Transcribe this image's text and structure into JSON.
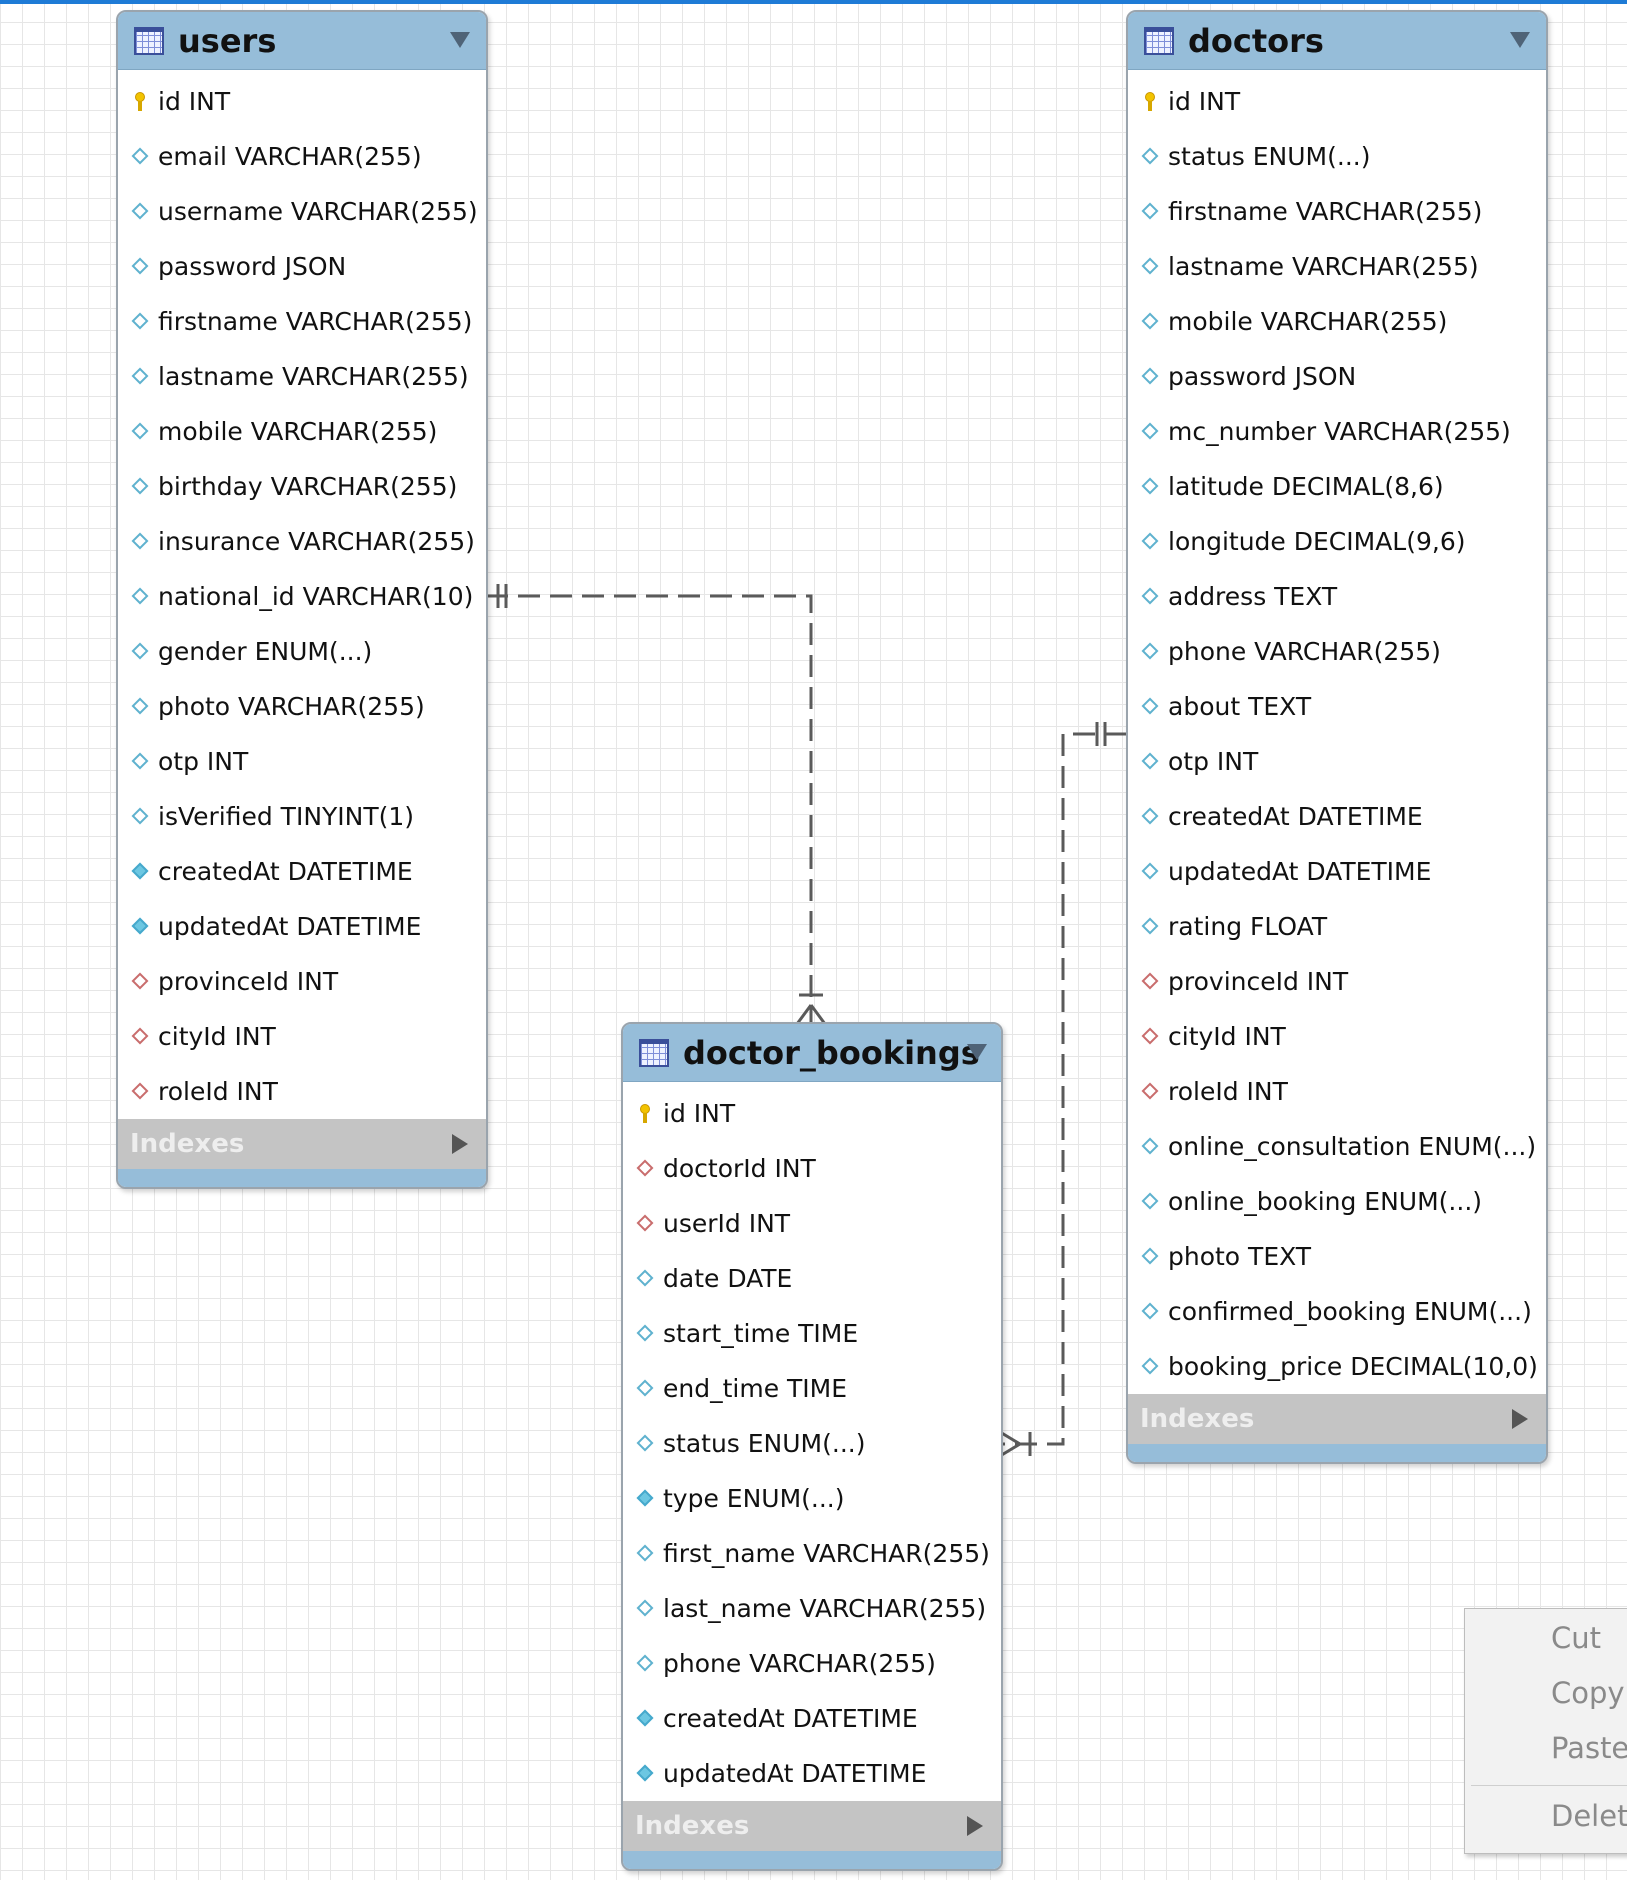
{
  "tables": {
    "users": {
      "title": "users",
      "indexes_label": "Indexes",
      "columns": [
        {
          "label": "id INT",
          "icon": "primary-key-icon"
        },
        {
          "label": "email VARCHAR(255)",
          "icon": "column-diamond-icon"
        },
        {
          "label": "username VARCHAR(255)",
          "icon": "column-diamond-icon"
        },
        {
          "label": "password JSON",
          "icon": "column-diamond-icon"
        },
        {
          "label": "firstname VARCHAR(255)",
          "icon": "column-diamond-icon"
        },
        {
          "label": "lastname VARCHAR(255)",
          "icon": "column-diamond-icon"
        },
        {
          "label": "mobile VARCHAR(255)",
          "icon": "column-diamond-icon"
        },
        {
          "label": "birthday VARCHAR(255)",
          "icon": "column-diamond-icon"
        },
        {
          "label": "insurance VARCHAR(255)",
          "icon": "column-diamond-icon"
        },
        {
          "label": "national_id VARCHAR(10)",
          "icon": "column-diamond-icon"
        },
        {
          "label": "gender ENUM(...)",
          "icon": "column-diamond-icon"
        },
        {
          "label": "photo VARCHAR(255)",
          "icon": "column-diamond-icon"
        },
        {
          "label": "otp INT",
          "icon": "column-diamond-icon"
        },
        {
          "label": "isVerified TINYINT(1)",
          "icon": "column-diamond-icon"
        },
        {
          "label": "createdAt DATETIME",
          "icon": "column-filled-diamond-icon"
        },
        {
          "label": "updatedAt DATETIME",
          "icon": "column-filled-diamond-icon"
        },
        {
          "label": "provinceId INT",
          "icon": "foreign-key-diamond-icon"
        },
        {
          "label": "cityId INT",
          "icon": "foreign-key-diamond-icon"
        },
        {
          "label": "roleId INT",
          "icon": "foreign-key-diamond-icon"
        }
      ]
    },
    "doctors": {
      "title": "doctors",
      "indexes_label": "Indexes",
      "columns": [
        {
          "label": "id INT",
          "icon": "primary-key-icon"
        },
        {
          "label": "status ENUM(...)",
          "icon": "column-diamond-icon"
        },
        {
          "label": "firstname VARCHAR(255)",
          "icon": "column-diamond-icon"
        },
        {
          "label": "lastname VARCHAR(255)",
          "icon": "column-diamond-icon"
        },
        {
          "label": "mobile VARCHAR(255)",
          "icon": "column-diamond-icon"
        },
        {
          "label": "password JSON",
          "icon": "column-diamond-icon"
        },
        {
          "label": "mc_number VARCHAR(255)",
          "icon": "column-diamond-icon"
        },
        {
          "label": "latitude DECIMAL(8,6)",
          "icon": "column-diamond-icon"
        },
        {
          "label": "longitude DECIMAL(9,6)",
          "icon": "column-diamond-icon"
        },
        {
          "label": "address TEXT",
          "icon": "column-diamond-icon"
        },
        {
          "label": "phone VARCHAR(255)",
          "icon": "column-diamond-icon"
        },
        {
          "label": "about TEXT",
          "icon": "column-diamond-icon"
        },
        {
          "label": "otp INT",
          "icon": "column-diamond-icon"
        },
        {
          "label": "createdAt DATETIME",
          "icon": "column-diamond-icon"
        },
        {
          "label": "updatedAt DATETIME",
          "icon": "column-diamond-icon"
        },
        {
          "label": "rating FLOAT",
          "icon": "column-diamond-icon"
        },
        {
          "label": "provinceId INT",
          "icon": "foreign-key-diamond-icon"
        },
        {
          "label": "cityId INT",
          "icon": "foreign-key-diamond-icon"
        },
        {
          "label": "roleId INT",
          "icon": "foreign-key-diamond-icon"
        },
        {
          "label": "online_consultation ENUM(...)",
          "icon": "column-diamond-icon"
        },
        {
          "label": "online_booking ENUM(...)",
          "icon": "column-diamond-icon"
        },
        {
          "label": "photo TEXT",
          "icon": "column-diamond-icon"
        },
        {
          "label": "confirmed_booking ENUM(...)",
          "icon": "column-diamond-icon"
        },
        {
          "label": "booking_price DECIMAL(10,0)",
          "icon": "column-diamond-icon"
        }
      ]
    },
    "doctor_bookings": {
      "title": "doctor_bookings",
      "indexes_label": "Indexes",
      "columns": [
        {
          "label": "id INT",
          "icon": "primary-key-icon"
        },
        {
          "label": "doctorId INT",
          "icon": "foreign-key-diamond-icon"
        },
        {
          "label": "userId INT",
          "icon": "foreign-key-diamond-icon"
        },
        {
          "label": "date DATE",
          "icon": "column-diamond-icon"
        },
        {
          "label": "start_time TIME",
          "icon": "column-diamond-icon"
        },
        {
          "label": "end_time TIME",
          "icon": "column-diamond-icon"
        },
        {
          "label": "status ENUM(...)",
          "icon": "column-diamond-icon"
        },
        {
          "label": "type ENUM(...)",
          "icon": "column-filled-diamond-icon"
        },
        {
          "label": "first_name VARCHAR(255)",
          "icon": "column-diamond-icon"
        },
        {
          "label": "last_name VARCHAR(255)",
          "icon": "column-diamond-icon"
        },
        {
          "label": "phone VARCHAR(255)",
          "icon": "column-diamond-icon"
        },
        {
          "label": "createdAt DATETIME",
          "icon": "column-filled-diamond-icon"
        },
        {
          "label": "updatedAt DATETIME",
          "icon": "column-filled-diamond-icon"
        }
      ]
    }
  },
  "relationships": [
    {
      "from": "users",
      "to": "doctor_bookings",
      "from_cardinality": "one",
      "to_cardinality": "many"
    },
    {
      "from": "doctors",
      "to": "doctor_bookings",
      "from_cardinality": "one",
      "to_cardinality": "many"
    }
  ],
  "context_menu": {
    "cut": "Cut",
    "copy": "Copy",
    "paste": "Paste",
    "delete": "Delete"
  },
  "colors": {
    "header": "#96bdd9",
    "indexes_bar": "#c4c4c4",
    "accent": "#1e7bd6"
  }
}
